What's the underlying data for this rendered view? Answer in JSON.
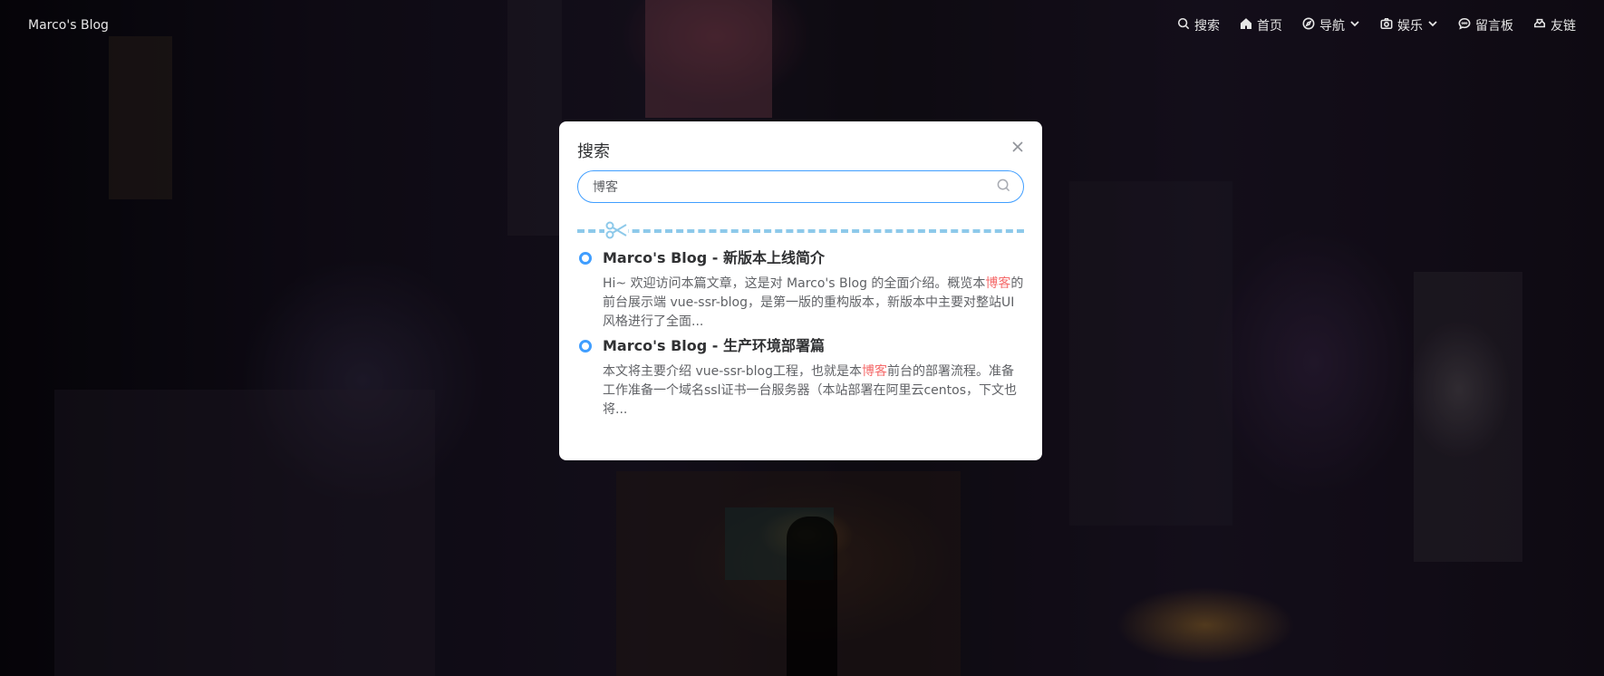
{
  "header": {
    "logo": "Marco's Blog",
    "nav": [
      {
        "label": "搜索",
        "icon": "search-icon"
      },
      {
        "label": "首页",
        "icon": "home-icon"
      },
      {
        "label": "导航",
        "icon": "compass-icon",
        "dropdown": true
      },
      {
        "label": "娱乐",
        "icon": "camera-icon",
        "dropdown": true
      },
      {
        "label": "留言板",
        "icon": "chat-icon"
      },
      {
        "label": "友链",
        "icon": "handshake-icon"
      }
    ]
  },
  "modal": {
    "title": "搜索",
    "search": {
      "value": "博客"
    },
    "results": [
      {
        "title": "Marco's Blog - 新版本上线简介",
        "desc_before": "Hi~ 欢迎访问本篇文章，这是对 Marco's Blog 的全面介绍。概览本",
        "highlight": "博客",
        "desc_after": "的前台展示端 vue-ssr-blog，是第一版的重构版本，新版本中主要对整站UI风格进行了全面..."
      },
      {
        "title": "Marco's Blog - 生产环境部署篇",
        "desc_before": "本文将主要介绍 vue-ssr-blog工程，也就是本",
        "highlight": "博客",
        "desc_after": "前台的部署流程。准备工作准备一个域名ssl证书一台服务器（本站部署在阿里云centos，下文也将..."
      }
    ]
  },
  "colors": {
    "accent": "#409eff",
    "highlight": "#f56c6c",
    "divider": "#8dc9ea"
  }
}
